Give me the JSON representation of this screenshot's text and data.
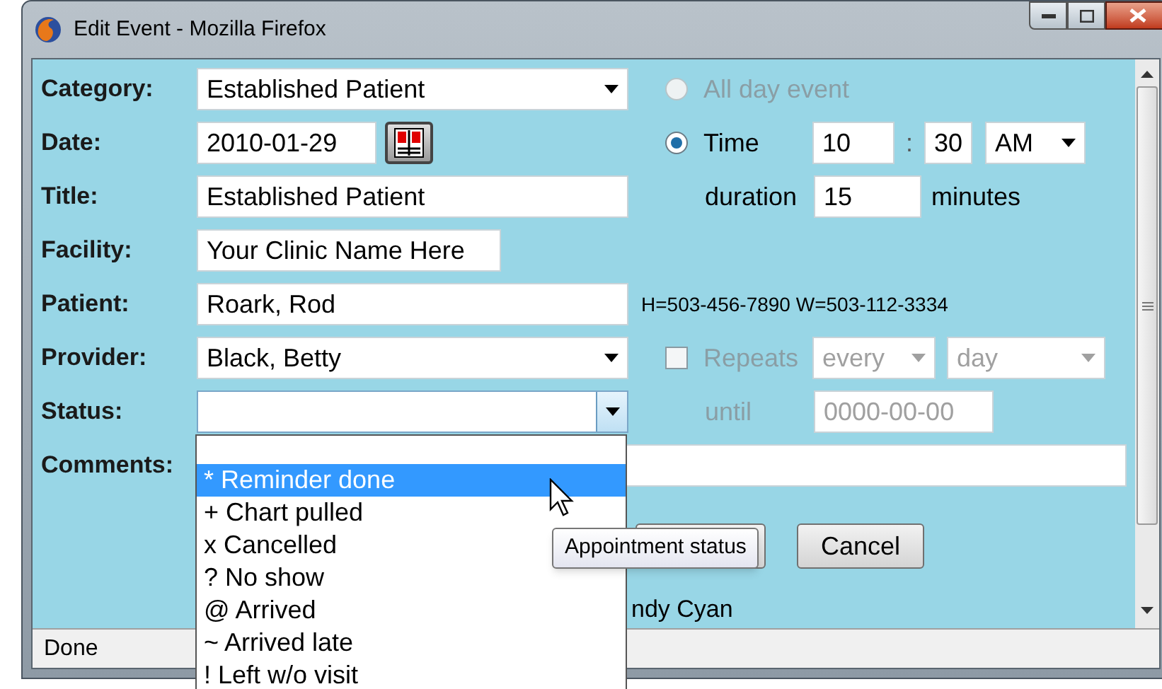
{
  "window": {
    "title": "Edit Event - Mozilla Firefox"
  },
  "form": {
    "category": {
      "label": "Category:",
      "value": "Established Patient"
    },
    "date": {
      "label": "Date:",
      "value": "2010-01-29"
    },
    "title": {
      "label": "Title:",
      "value": "Established Patient"
    },
    "facility": {
      "label": "Facility:",
      "value": "Your Clinic Name Here"
    },
    "patient": {
      "label": "Patient:",
      "value": "Roark, Rod",
      "phones": "H=503-456-7890 W=503-112-3334"
    },
    "provider": {
      "label": "Provider:",
      "value": "Black, Betty"
    },
    "status": {
      "label": "Status:"
    },
    "comments": {
      "label": "Comments:"
    }
  },
  "timing": {
    "all_day": {
      "label": "All day event",
      "selected": false,
      "disabled": true
    },
    "time": {
      "label": "Time",
      "selected": true,
      "hour": "10",
      "separator": ":",
      "minute": "30",
      "ampm": "AM"
    },
    "duration": {
      "label": "duration",
      "value": "15",
      "unit": "minutes"
    },
    "repeats": {
      "label": "Repeats",
      "checked": false,
      "every": "every",
      "unit": "day",
      "until_label": "until",
      "until_value": "0000-00-00"
    }
  },
  "buttons": [
    {
      "label": "Cancel"
    }
  ],
  "partial_text": "ndy Cyan",
  "status_dropdown": {
    "options": [
      {
        "label": "* Reminder done",
        "selected": true
      },
      {
        "label": "+ Chart pulled",
        "selected": false
      },
      {
        "label": "x Cancelled",
        "selected": false
      },
      {
        "label": "? No show",
        "selected": false
      },
      {
        "label": "@ Arrived",
        "selected": false
      },
      {
        "label": "~ Arrived late",
        "selected": false
      },
      {
        "label": "! Left w/o visit",
        "selected": false
      }
    ]
  },
  "tooltip": "Appointment status",
  "status_bar": "Done"
}
